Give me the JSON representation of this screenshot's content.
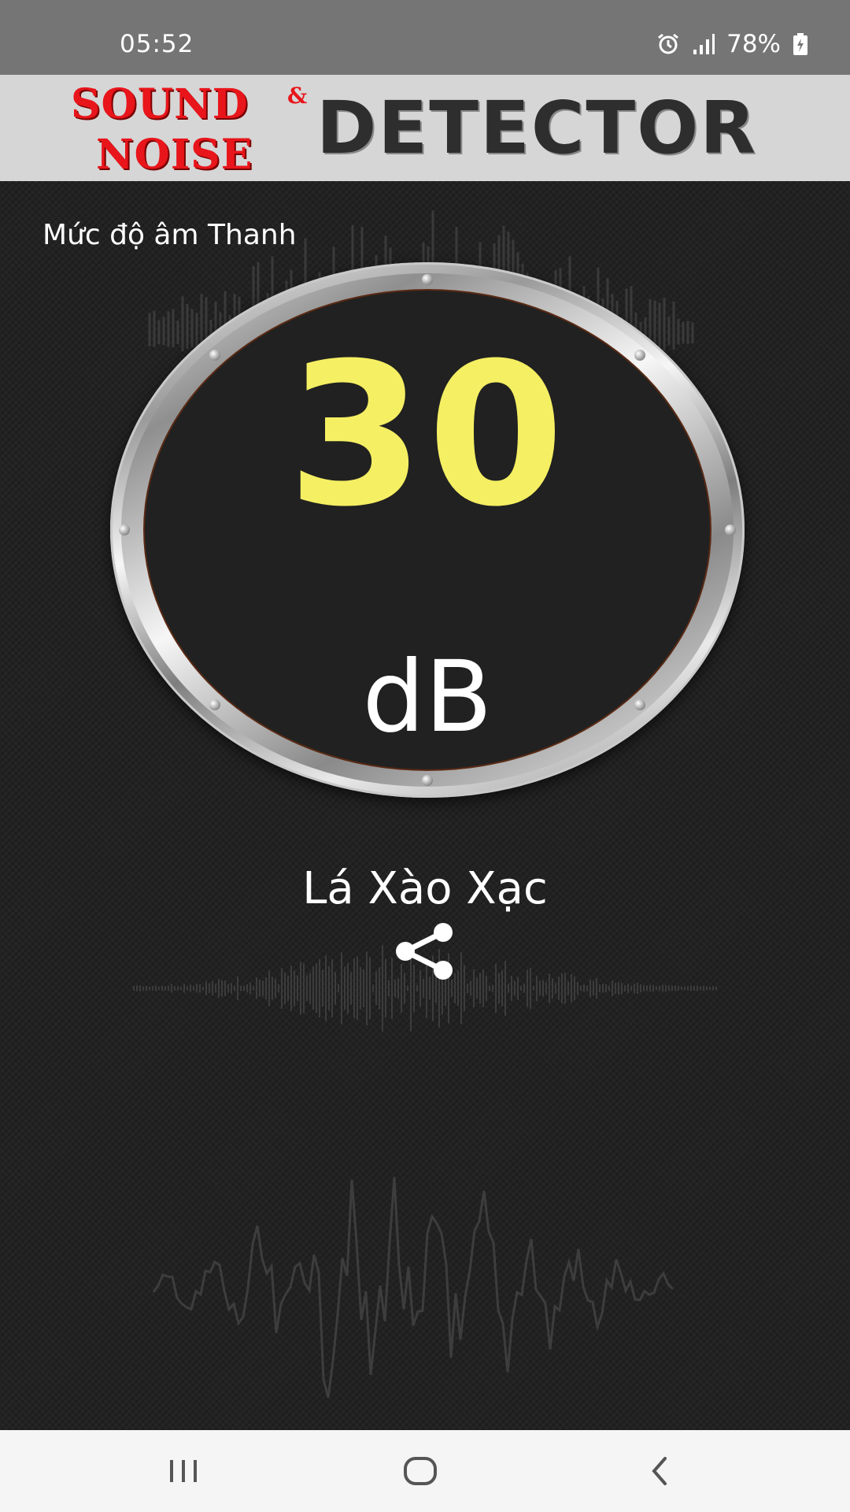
{
  "status_bar": {
    "time": "05:52",
    "battery_percent": "78%",
    "icons": [
      "alarm-icon",
      "signal-icon",
      "battery-charging-icon"
    ]
  },
  "header": {
    "logo_word_1": "SOUND",
    "logo_ampersand": "&",
    "logo_word_2": "NOISE",
    "logo_word_3": "DETECTOR"
  },
  "meter": {
    "title": "Mức độ âm Thanh",
    "value": "30",
    "unit": "dB",
    "sound_description": "Lá Xào Xạc"
  },
  "actions": {
    "share_icon": "share-icon"
  },
  "nav_bar": {
    "icons": [
      "recent-apps-icon",
      "home-icon",
      "back-icon"
    ]
  },
  "colors": {
    "value_color": "#f5ef63",
    "logo_red": "#e8151b",
    "logo_dark": "#2e2e2e",
    "background": "#222222",
    "status_bar": "#757575"
  }
}
